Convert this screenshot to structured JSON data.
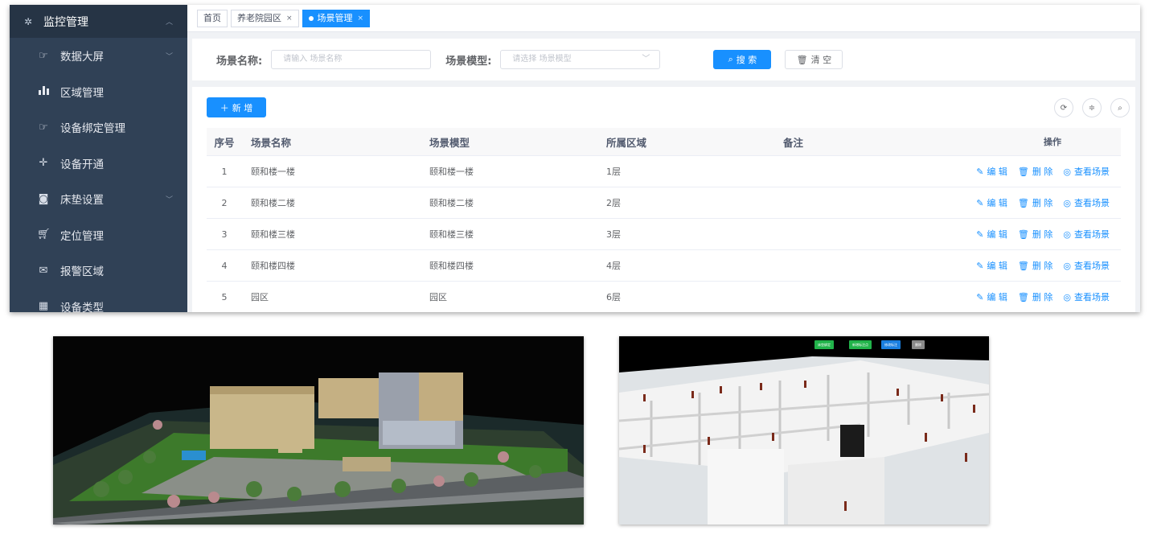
{
  "sidebar": {
    "header": {
      "label": "监控管理",
      "icon": "gear-icon"
    },
    "items": [
      {
        "label": "数据大屏",
        "icon": "hand-point-icon",
        "has_arrow": true
      },
      {
        "label": "区域管理",
        "icon": "bar-chart-icon"
      },
      {
        "label": "设备绑定管理",
        "icon": "hand-point-icon"
      },
      {
        "label": "设备开通",
        "icon": "move-icon"
      },
      {
        "label": "床垫设置",
        "icon": "camera-icon",
        "has_arrow": true
      },
      {
        "label": "定位管理",
        "icon": "cart-icon"
      },
      {
        "label": "报警区域",
        "icon": "message-icon"
      },
      {
        "label": "设备类型",
        "icon": "grid-icon"
      }
    ]
  },
  "tags": [
    {
      "label": "首页",
      "closable": false,
      "active": false
    },
    {
      "label": "养老院园区",
      "closable": true,
      "active": false
    },
    {
      "label": "场景管理",
      "closable": true,
      "active": true
    }
  ],
  "search": {
    "name_label": "场景名称:",
    "name_placeholder": "请输入 场景名称",
    "model_label": "场景模型:",
    "model_placeholder": "请选择 场景模型",
    "search_button": "搜 索",
    "clear_button": "清 空"
  },
  "toolbar": {
    "add_button": "新 增",
    "tools": [
      "refresh-icon",
      "columns-setting-icon",
      "search-toggle-icon"
    ]
  },
  "table": {
    "headers": {
      "index": "序号",
      "name": "场景名称",
      "model": "场景模型",
      "area": "所属区域",
      "remark": "备注",
      "ops": "操作"
    },
    "actions": {
      "edit": "编 辑",
      "delete": "删 除",
      "view": "查看场景"
    },
    "rows": [
      {
        "index": "1",
        "name": "颐和楼一楼",
        "model": "颐和楼一楼",
        "area": "1层",
        "remark": ""
      },
      {
        "index": "2",
        "name": "颐和楼二楼",
        "model": "颐和楼二楼",
        "area": "2层",
        "remark": ""
      },
      {
        "index": "3",
        "name": "颐和楼三楼",
        "model": "颐和楼三楼",
        "area": "3层",
        "remark": ""
      },
      {
        "index": "4",
        "name": "颐和楼四楼",
        "model": "颐和楼四楼",
        "area": "4层",
        "remark": ""
      },
      {
        "index": "5",
        "name": "园区",
        "model": "园区",
        "area": "6层",
        "remark": ""
      }
    ]
  },
  "floor_scene": {
    "buttons": [
      {
        "label": "床垫绑定",
        "color": "#21b34a"
      },
      {
        "label": "新增标注点",
        "color": "#21b34a"
      },
      {
        "label": "修改标注",
        "color": "#1a7fe0"
      },
      {
        "label": "删除",
        "color": "#8a8a8a"
      }
    ]
  },
  "colors": {
    "sidebar_bg": "#304156",
    "accent": "#1890ff",
    "page_bg": "#f0f2f5"
  }
}
